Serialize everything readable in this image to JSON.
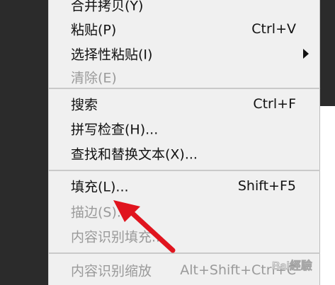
{
  "menu": {
    "items": [
      {
        "label": "合并拷贝(Y)",
        "shortcut": "",
        "disabled": false
      },
      {
        "label": "粘贴(P)",
        "shortcut": "Ctrl+V",
        "disabled": false
      },
      {
        "label": "选择性粘贴(I)",
        "shortcut": "",
        "disabled": false,
        "submenu": true
      },
      {
        "label": "清除(E)",
        "shortcut": "",
        "disabled": true
      },
      {
        "label": "搜索",
        "shortcut": "Ctrl+F",
        "disabled": false
      },
      {
        "label": "拼写检查(H)...",
        "shortcut": "",
        "disabled": false
      },
      {
        "label": "查找和替换文本(X)...",
        "shortcut": "",
        "disabled": false
      },
      {
        "label": "填充(L)...",
        "shortcut": "Shift+F5",
        "disabled": false
      },
      {
        "label": "描边(S)...",
        "shortcut": "",
        "disabled": true
      },
      {
        "label": "内容识别填充...",
        "shortcut": "",
        "disabled": true
      },
      {
        "label": "内容识别缩放",
        "shortcut": "Alt+Shift+Ctrl+C",
        "disabled": true
      }
    ]
  },
  "annotation": {
    "arrow_color": "#e0141e"
  },
  "watermark": {
    "text": "Bai經驗"
  }
}
